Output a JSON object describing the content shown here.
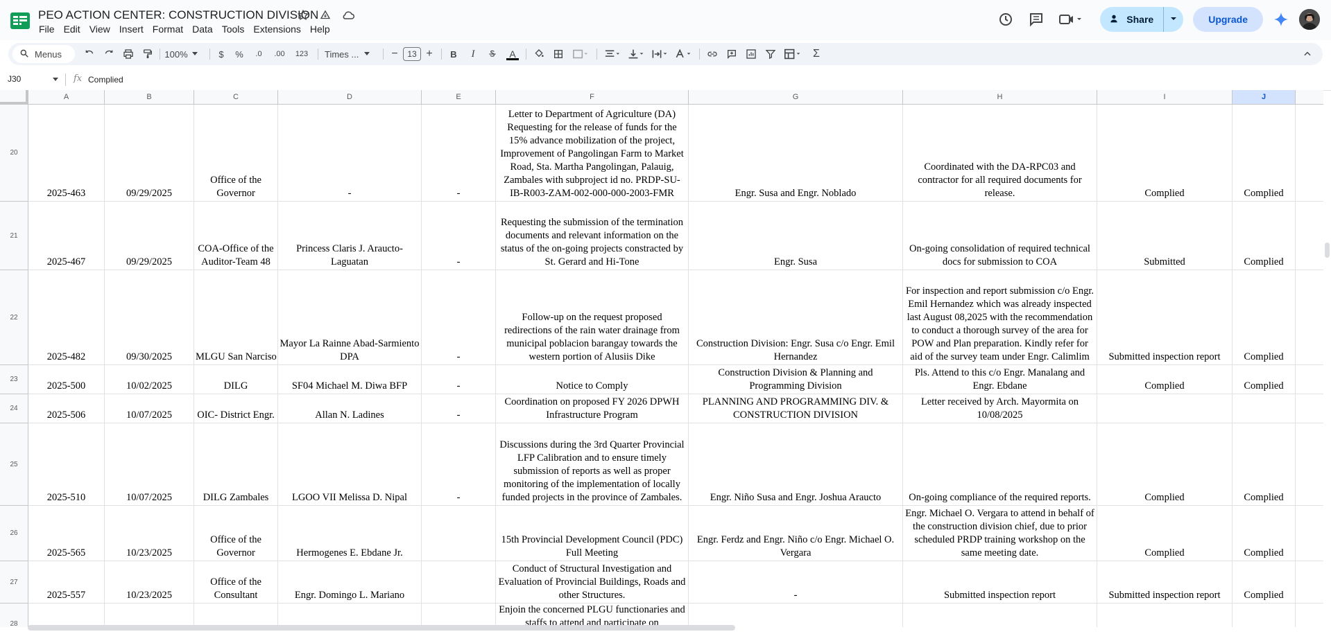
{
  "app": {
    "title": "PEO ACTION CENTER: CONSTRUCTION DIVISION",
    "menus": [
      "File",
      "Edit",
      "View",
      "Insert",
      "Format",
      "Data",
      "Tools",
      "Extensions",
      "Help"
    ],
    "share_label": "Share",
    "upgrade_label": "Upgrade"
  },
  "toolbar": {
    "search_label": "Menus",
    "zoom": "100%",
    "currency": "$",
    "percent": "%",
    "decrease_decimal": ".0",
    "increase_decimal": ".00",
    "number_format": "123",
    "font": "Times ...",
    "font_size": "13",
    "minus": "−",
    "plus": "+",
    "bold": "B",
    "italic": "I",
    "text_color": "A",
    "sum": "Σ"
  },
  "formula_bar": {
    "cell_ref": "J30",
    "fx": "fx",
    "value": "Complied"
  },
  "columns": [
    "A",
    "B",
    "C",
    "D",
    "E",
    "F",
    "G",
    "H",
    "I",
    "J"
  ],
  "selected_column": "J",
  "rows": [
    {
      "num": "20",
      "cells": [
        "2025-463",
        "09/29/2025",
        "Office of the Governor",
        "-",
        "-",
        "Letter to Department of Agriculture (DA) Requesting for the release of funds for the 15% advance mobilization of the project, Improvement of Pangolingan Farm to Market Road, Sta. Martha Pangolingan, Palauig, Zambales with subproject id no. PRDP-SU-IB-R003-ZAM-002-000-000-2003-FMR",
        "Engr. Susa and Engr. Noblado",
        "Coordinated with the DA-RPC03 and contractor for all required documents for release.",
        "Complied",
        "Complied"
      ]
    },
    {
      "num": "21",
      "cells": [
        "2025-467",
        "09/29/2025",
        "COA-Office of the Auditor-Team 48",
        "Princess Claris J. Araucto-Laguatan",
        "-",
        "Requesting the submission of the termination documents and relevant information on the status of the on-going projects constracted by St. Gerard and Hi-Tone",
        "Engr. Susa",
        "On-going consolidation of required technical docs for submission to COA",
        "Submitted",
        "Complied"
      ]
    },
    {
      "num": "22",
      "cells": [
        "2025-482",
        "09/30/2025",
        "MLGU San Narciso",
        "Mayor La Rainne Abad-Sarmiento DPA",
        "-",
        "Follow-up on the request proposed redirections of the rain water drainage from municipal poblacion barangay towards the western portion of Alusiis Dike",
        "Construction Division: Engr. Susa c/o Engr. Emil Hernandez",
        "For inspection and report submission c/o Engr. Emil Hernandez which was already inspected last August 08,2025 with the recommendation to conduct a thorough survey of the area for POW and Plan preparation. Kindly refer for aid of the survey team under Engr. Calimlim",
        "Submitted inspection report",
        "Complied"
      ]
    },
    {
      "num": "23",
      "cells": [
        "2025-500",
        "10/02/2025",
        "DILG",
        "SF04 Michael M. Diwa BFP",
        "-",
        "Notice to Comply",
        "Construction Division & Planning and Programming Division",
        "Pls. Attend to this c/o Engr. Manalang and Engr. Ebdane",
        "Complied",
        "Complied"
      ]
    },
    {
      "num": "24",
      "cells": [
        "2025-506",
        "10/07/2025",
        "OIC- District Engr.",
        "Allan N. Ladines",
        "-",
        "Coordination on proposed FY 2026 DPWH Infrastructure Program",
        "PLANNING AND PROGRAMMING DIV. & CONSTRUCTION DIVISION",
        "Letter received by Arch. Mayormita on 10/08/2025",
        "",
        ""
      ]
    },
    {
      "num": "25",
      "cells": [
        "2025-510",
        "10/07/2025",
        "DILG Zambales",
        "LGOO VII Melissa D. Nipal",
        "-",
        "Discussions during the 3rd Quarter Provincial LFP Calibration and to ensure timely submission of reports as well as proper monitoring of the implementation of locally funded projects in the province of Zambales.",
        "Engr. Niño Susa and Engr. Joshua Araucto",
        "On-going compliance of the required reports.",
        "Complied",
        "Complied"
      ]
    },
    {
      "num": "26",
      "cells": [
        "2025-565",
        "10/23/2025",
        "Office of the Governor",
        "Hermogenes E. Ebdane Jr.",
        "",
        "15th Provincial Development Council (PDC) Full Meeting",
        "Engr. Ferdz and Engr. Niño c/o Engr. Michael O. Vergara",
        "Engr. Michael O. Vergara to attend in behalf of the construction division chief, due to prior scheduled PRDP training workshop on the same meeting date.",
        "Complied",
        "Complied"
      ]
    },
    {
      "num": "27",
      "cells": [
        "2025-557",
        "10/23/2025",
        "Office of the Consultant",
        "Engr. Domingo L. Mariano",
        "",
        "Conduct of Structural Investigation and Evaluation of Provincial Buildings, Roads and other Structures.",
        "-",
        "Submitted inspection report",
        "Submitted inspection report",
        "Complied"
      ]
    },
    {
      "num": "28",
      "cells": [
        "",
        "",
        "",
        "",
        "",
        "Enjoin the concerned PLGU functionaries and staffs to attend and participate on",
        "",
        "",
        "",
        ""
      ]
    }
  ],
  "colors": {
    "accent": "#0b57d0",
    "share_bg": "#c2e7ff",
    "upgrade_bg": "#d3e3fd",
    "header_bg": "#f8f9fa"
  },
  "icons": [
    "sheets-logo-icon",
    "star-icon",
    "move-to-drive-icon",
    "cloud-status-icon",
    "history-icon",
    "comment-icon",
    "meet-icon",
    "share-icon",
    "gemini-icon",
    "search-icon",
    "undo-icon",
    "redo-icon",
    "print-icon",
    "paint-format-icon",
    "chevron-down-icon",
    "fill-color-icon",
    "borders-icon",
    "merge-icon",
    "align-icon",
    "valign-icon",
    "text-wrap-icon",
    "text-rotate-icon",
    "link-icon",
    "insert-comment-icon",
    "insert-chart-icon",
    "filter-icon",
    "table-view-icon",
    "function-icon",
    "collapse-icon"
  ]
}
